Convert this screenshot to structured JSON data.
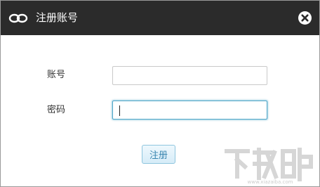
{
  "window": {
    "title": "注册账号",
    "app_icon": "chain-link-icon",
    "close_icon": "close-circle-icon",
    "titlebar_color": "#2b2b2b",
    "accent_color": "#51a7c9"
  },
  "form": {
    "account_label": "账号",
    "account_value": "",
    "password_label": "密码",
    "password_value": "",
    "submit_label": "注册"
  },
  "watermark": {
    "text": "下载吧",
    "subtext": "www.xiazaiba.com"
  }
}
